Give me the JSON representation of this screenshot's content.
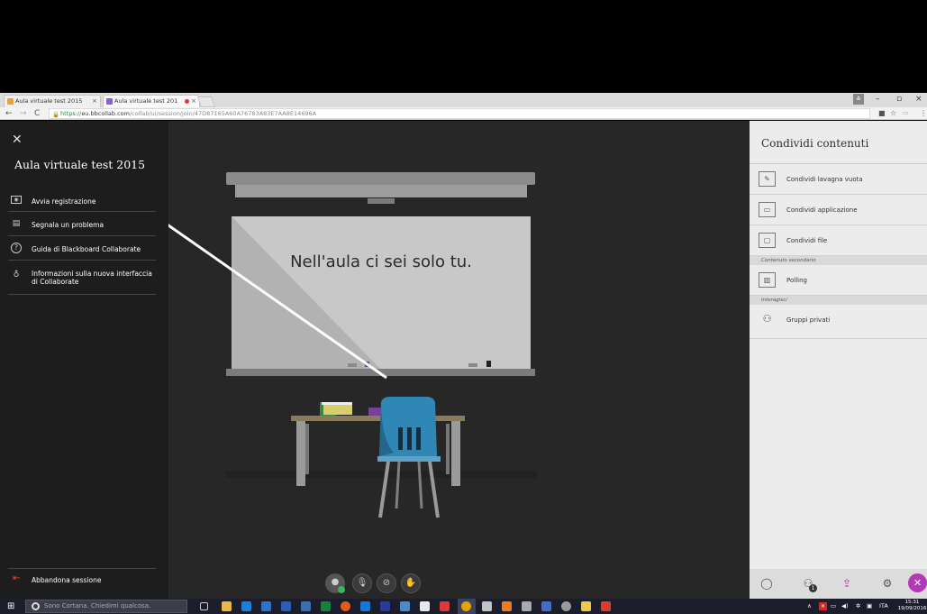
{
  "browser": {
    "tabs": [
      {
        "label": "Aula virtuale test 2015",
        "favicon_color": "#e8a23b"
      },
      {
        "label": "Aula virtuale test 201",
        "favicon_color": "#8b5fd1",
        "recording_dot": true
      }
    ],
    "url_scheme": "https://",
    "url_host": "eu.bbcollab.com",
    "url_path": "/collab/ui/session/join/47D87165A60A76783A83E7AA8E14696A"
  },
  "left_panel": {
    "title": "Aula virtuale test 2015",
    "menu": [
      {
        "label": "Avvia registrazione",
        "icon": "record-icon"
      },
      {
        "label": "Segnala un problema",
        "icon": "report-icon"
      },
      {
        "label": "Guida di Blackboard Collaborate",
        "icon": "help-icon"
      },
      {
        "label": "Informazioni sulla nuova interfaccia di Collaborate",
        "icon": "lightbulb-icon"
      }
    ],
    "leave_label": "Abbandona sessione"
  },
  "stage": {
    "message": "Nell'aula ci sei solo tu."
  },
  "right_panel": {
    "title": "Condividi contenuti",
    "items": [
      {
        "label": "Condividi lavagna vuota",
        "icon": "whiteboard-icon"
      },
      {
        "label": "Condividi applicazione",
        "icon": "application-icon"
      },
      {
        "label": "Condividi file",
        "icon": "file-icon"
      }
    ],
    "section_secondary": "Contenuto secondario",
    "secondary_items": [
      {
        "label": "Polling",
        "icon": "polling-icon"
      }
    ],
    "section_groups": "Interagisci",
    "group_items": [
      {
        "label": "Gruppi privati",
        "icon": "breakout-groups-icon"
      }
    ],
    "attendee_badge": "1"
  },
  "taskbar": {
    "search_placeholder": "Sono Cortana. Chiedimi qualcosa.",
    "language": "ITA",
    "time": "15:31",
    "date": "19/09/2016"
  },
  "colors": {
    "accent": "#b23ab6",
    "chair": "#2f87b5",
    "arrow": "#ffffff"
  }
}
